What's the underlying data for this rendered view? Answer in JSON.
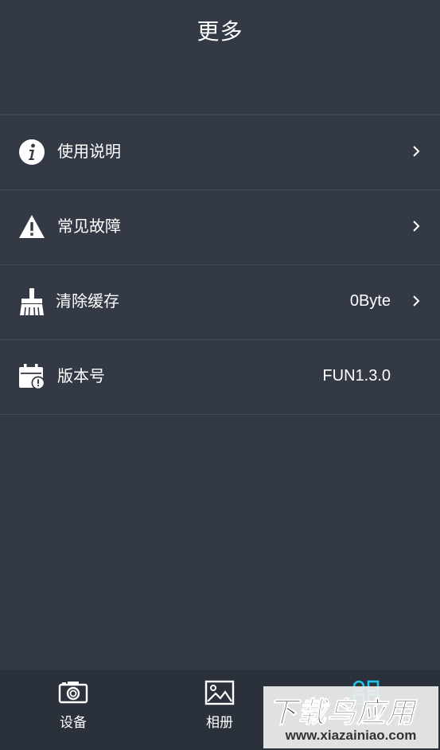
{
  "header": {
    "title": "更多"
  },
  "menu": {
    "items": [
      {
        "icon": "info-icon",
        "label": "使用说明",
        "value": "",
        "has_chevron": true
      },
      {
        "icon": "warning-icon",
        "label": "常见故障",
        "value": "",
        "has_chevron": true
      },
      {
        "icon": "broom-icon",
        "label": "清除缓存",
        "value": "0Byte",
        "has_chevron": true
      },
      {
        "icon": "calendar-alert-icon",
        "label": "版本号",
        "value": "FUN1.3.0",
        "has_chevron": false
      }
    ]
  },
  "tabbar": {
    "tabs": [
      {
        "icon": "camera-icon",
        "label": "设备"
      },
      {
        "icon": "image-icon",
        "label": "相册"
      },
      {
        "icon": "grid-icon",
        "label": "",
        "active": true
      }
    ],
    "active_color": "#1ec8e6"
  },
  "watermark": {
    "text": "下载鸟应用",
    "url": "www.xiazainiao.com"
  },
  "colors": {
    "background": "#333a45",
    "tabbar": "#2b313b",
    "divider": "#454c58",
    "text": "#ffffff"
  }
}
